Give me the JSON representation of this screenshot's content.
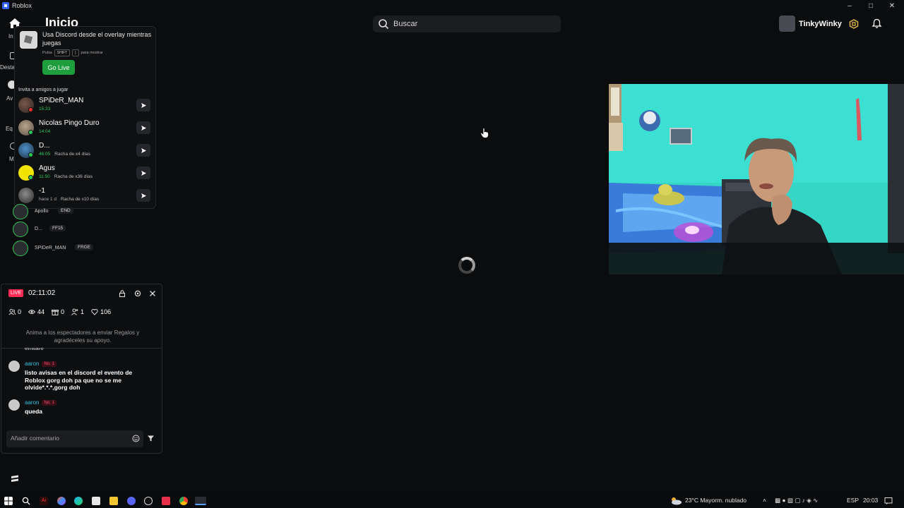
{
  "window": {
    "title": "Roblox"
  },
  "header": {
    "page_title": "Inicio",
    "search_placeholder": "Buscar",
    "username": "TinkyWinky"
  },
  "rail": {
    "labels": [
      "In",
      "Desta",
      "Av",
      "Eq",
      "M"
    ]
  },
  "overlay": {
    "message": "Usa Discord desde el overlay mientras juegas",
    "hint_press": "Pulsa",
    "hint_key1": "SHIFT",
    "hint_key2": "|",
    "hint_show": "para mostrar",
    "go_live_label": "Go Live",
    "invite_title": "Invita a amigos a jugar",
    "friends": [
      {
        "name": "SPiDeR_MAN",
        "time": "15:33",
        "streak": ""
      },
      {
        "name": "Nicolas Pingo Duro",
        "time": "14:04",
        "streak": ""
      },
      {
        "name": "D...",
        "time": "46:05",
        "streak": "Racha de x4 días"
      },
      {
        "name": "Agus",
        "time": "11:50",
        "streak": "Racha de x36 días"
      },
      {
        "name": "-1",
        "time": "hace 1 d",
        "streak": "Racha de x10 días"
      }
    ]
  },
  "friends_list": [
    {
      "name": "Apollo",
      "tag": "END"
    },
    {
      "name": "D...",
      "tag": "FF15"
    },
    {
      "name": "SPiDeR_MAN",
      "tag": "FRGE"
    }
  ],
  "live": {
    "badge": "LIVE",
    "timer": "02:11:02",
    "stats": {
      "viewers_a": "0",
      "views": "44",
      "gifts": "0",
      "shares": "1",
      "likes": "106"
    },
    "prompt": "Anima a los espectadores a enviar Regalos y agradéceles su apoyo.",
    "cut_text": "emitaré",
    "comments": [
      {
        "user": "aaron",
        "rank": "No. 1",
        "text": "listo avisas en el discord el evento de Roblox gorg doh pa que no se me olvide*.*.*,gorg doh"
      },
      {
        "user": "aaron",
        "rank": "No. 1",
        "text": "queda"
      }
    ],
    "input_placeholder": "Añadir comentario"
  },
  "taskbar": {
    "weather": "23°C  Mayorm. nublado",
    "lang": "ESP",
    "time": "20:03"
  }
}
